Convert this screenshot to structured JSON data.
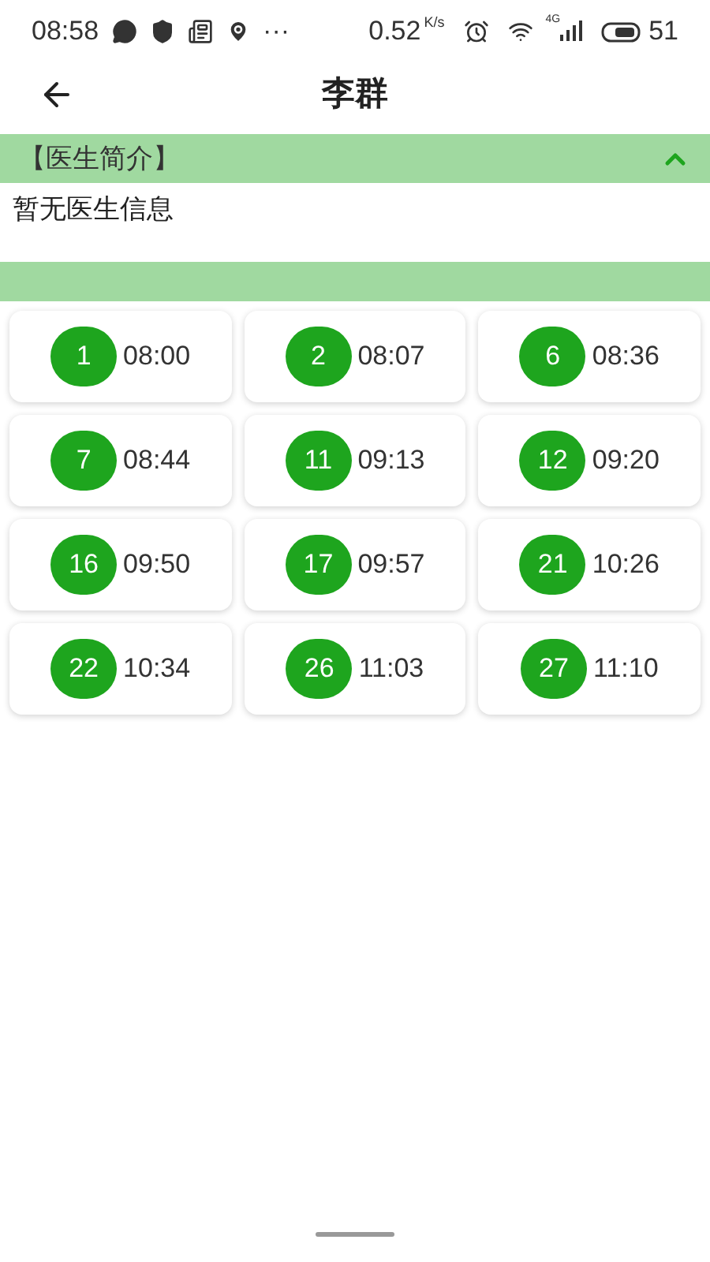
{
  "status_bar": {
    "time": "08:58",
    "more": "···",
    "speed": "0.52",
    "speed_unit": "K/s",
    "network": "4G",
    "battery": "51"
  },
  "header": {
    "title": "李群"
  },
  "intro": {
    "title": "【医生简介】",
    "expanded": true,
    "text": "暂无医生信息"
  },
  "slots": [
    {
      "number": "1",
      "time": "08:00"
    },
    {
      "number": "2",
      "time": "08:07"
    },
    {
      "number": "6",
      "time": "08:36"
    },
    {
      "number": "7",
      "time": "08:44"
    },
    {
      "number": "11",
      "time": "09:13"
    },
    {
      "number": "12",
      "time": "09:20"
    },
    {
      "number": "16",
      "time": "09:50"
    },
    {
      "number": "17",
      "time": "09:57"
    },
    {
      "number": "21",
      "time": "10:26"
    },
    {
      "number": "22",
      "time": "10:34"
    },
    {
      "number": "26",
      "time": "11:03"
    },
    {
      "number": "27",
      "time": "11:10"
    }
  ]
}
